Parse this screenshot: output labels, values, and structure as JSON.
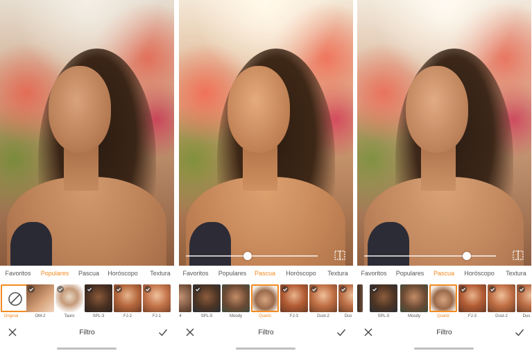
{
  "accent_color": "#f28a21",
  "screens": [
    {
      "show_slider": false,
      "slider_value": 0,
      "tabs": [
        {
          "label": "Favoritos",
          "active": false
        },
        {
          "label": "Populares",
          "active": true
        },
        {
          "label": "Pascua",
          "active": false
        },
        {
          "label": "Horóscopo",
          "active": false
        },
        {
          "label": "Textura",
          "active": false
        }
      ],
      "filters": [
        {
          "label": "Original",
          "icon": "none-icon",
          "selected": true,
          "check": false
        },
        {
          "label": "OM-2",
          "selected": false,
          "check": true
        },
        {
          "label": "Tauro",
          "selected": false,
          "check": true
        },
        {
          "label": "SPL-3",
          "selected": false,
          "check": true
        },
        {
          "label": "FJ-2",
          "selected": false,
          "check": true
        },
        {
          "label": "FJ-1",
          "selected": false,
          "check": true
        }
      ],
      "title": "Filtro"
    },
    {
      "show_slider": true,
      "slider_value": 0.47,
      "tabs": [
        {
          "label": "Favoritos",
          "active": false
        },
        {
          "label": "Populares",
          "active": false
        },
        {
          "label": "Pascua",
          "active": true
        },
        {
          "label": "Horóscopo",
          "active": false
        },
        {
          "label": "Textura",
          "active": false
        }
      ],
      "filters": [
        {
          "label": "4",
          "selected": false,
          "check": false
        },
        {
          "label": "SPL-5",
          "selected": false,
          "check": true
        },
        {
          "label": "Moody",
          "selected": false,
          "check": false
        },
        {
          "label": "Quartz",
          "selected": true,
          "check": false
        },
        {
          "label": "FJ-3",
          "selected": false,
          "check": true
        },
        {
          "label": "Dust-2",
          "selected": false,
          "check": true
        },
        {
          "label": "Dus",
          "selected": false,
          "check": true
        }
      ],
      "title": "Filtro"
    },
    {
      "show_slider": true,
      "slider_value": 0.78,
      "tabs": [
        {
          "label": "Favoritos",
          "active": false
        },
        {
          "label": "Populares",
          "active": false
        },
        {
          "label": "Pascua",
          "active": true
        },
        {
          "label": "Horóscopo",
          "active": false
        },
        {
          "label": "Textura",
          "active": false
        }
      ],
      "filters": [
        {
          "label": "SPL-5",
          "selected": false,
          "check": true
        },
        {
          "label": "Moody",
          "selected": false,
          "check": false
        },
        {
          "label": "Quartz",
          "selected": true,
          "check": false
        },
        {
          "label": "FJ-3",
          "selected": false,
          "check": true
        },
        {
          "label": "Dust-2",
          "selected": false,
          "check": true
        },
        {
          "label": "Dus",
          "selected": false,
          "check": true
        }
      ],
      "title": "Filtro"
    }
  ]
}
